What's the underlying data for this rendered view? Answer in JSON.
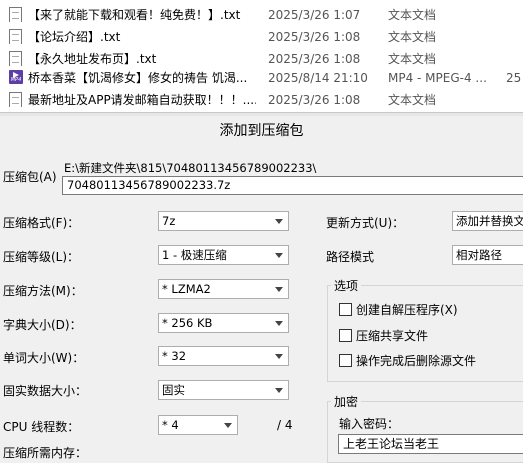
{
  "files": [
    {
      "name": "【来了就能下载和观看！纯免费！】.txt",
      "date": "2025/3/26 1:07",
      "type": "文本文档",
      "size": "",
      "icon": "text-file-icon"
    },
    {
      "name": "【论坛介绍】.txt",
      "date": "2025/3/26 1:08",
      "type": "文本文档",
      "size": "",
      "icon": "text-file-icon"
    },
    {
      "name": "【永久地址发布页】.txt",
      "date": "2025/3/26 1:08",
      "type": "文本文档",
      "size": "",
      "icon": "text-file-icon"
    },
    {
      "name": "桥本香菜【饥渴修女】修女的祷告 饥渴...",
      "date": "2025/8/14 21:10",
      "type": "MP4 - MPEG-4 ...",
      "size": "25",
      "icon": "mp4-file-icon"
    },
    {
      "name": "最新地址及APP请发邮箱自动获取！！！....",
      "date": "2025/3/26 1:08",
      "type": "文本文档",
      "size": "",
      "icon": "text-file-icon"
    }
  ],
  "dialog": {
    "title": "添加到压缩包",
    "archive_label": "压缩包(A)",
    "archive_path": "E:\\新建文件夹\\815\\70480113456789002233\\",
    "archive_name": "70480113456789002233.7z",
    "format_label": "压缩格式(F)：",
    "format_value": "7z",
    "level_label": "压缩等级(L)：",
    "level_value": "1 - 极速压缩",
    "method_label": "压缩方法(M)：",
    "method_value": "* LZMA2",
    "dict_label": "字典大小(D)：",
    "dict_value": "* 256 KB",
    "word_label": "单词大小(W)：",
    "word_value": "* 32",
    "solid_label": "固实数据大小：",
    "solid_value": "固实",
    "cpu_label": "CPU 线程数：",
    "cpu_value": "* 4",
    "cpu_total": "/ 4",
    "memory_label": "压缩所需内存：",
    "update_label": "更新方式(U)：",
    "update_value": "添加并替换文",
    "path_label": "路径模式",
    "path_value": "相对路径",
    "options_title": "选项",
    "opt_sfx": "创建自解压程序(X)",
    "opt_shared": "压缩共享文件",
    "opt_delete": "操作完成后删除源文件",
    "encrypt_title": "加密",
    "pwd_label": "输入密码：",
    "pwd_value": "上老王论坛当老王"
  }
}
